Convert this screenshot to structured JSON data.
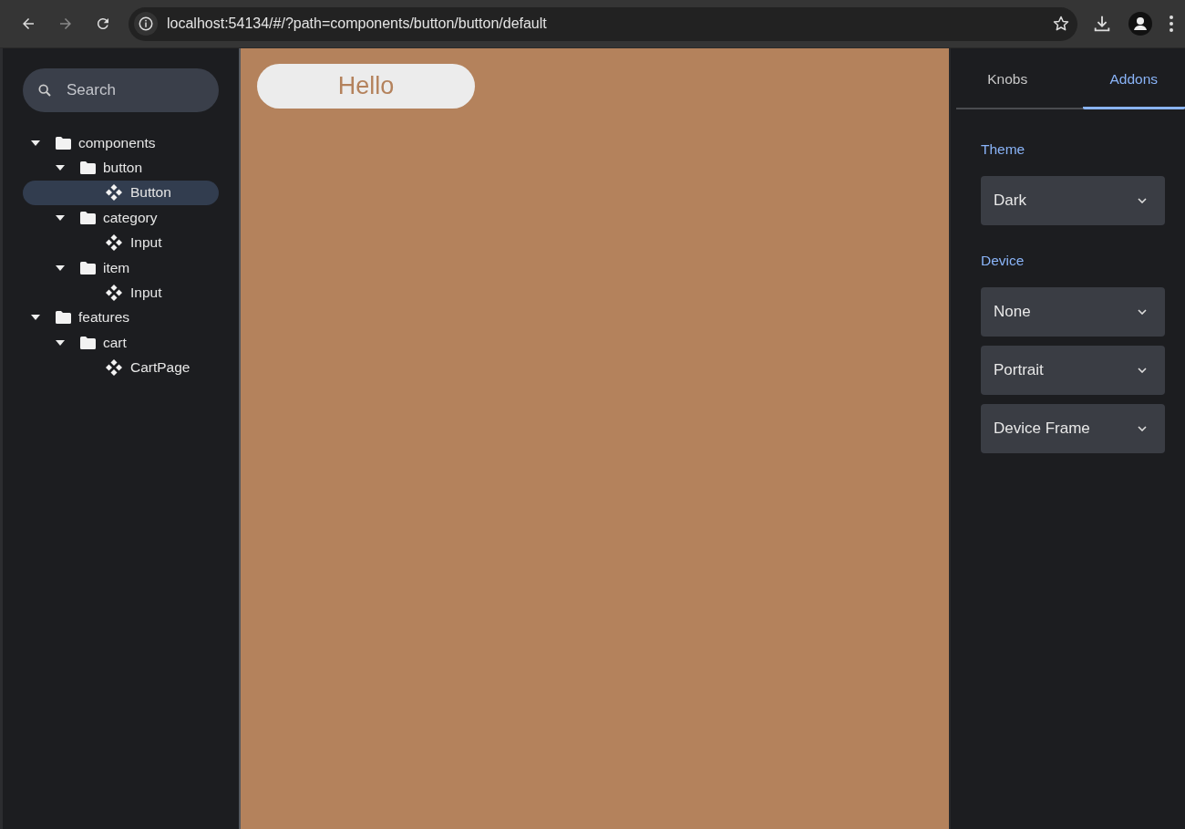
{
  "browser": {
    "url": "localhost:54134/#/?path=components/button/button/default"
  },
  "sidebar": {
    "search": {
      "placeholder": "Search"
    },
    "tree": [
      {
        "label": "components",
        "kind": "folder",
        "expanded": true,
        "selected": false,
        "children": [
          {
            "label": "button",
            "kind": "folder",
            "expanded": true,
            "selected": false,
            "children": [
              {
                "label": "Button",
                "kind": "story",
                "selected": true
              }
            ]
          },
          {
            "label": "category",
            "kind": "folder",
            "expanded": true,
            "selected": false,
            "children": [
              {
                "label": "Input",
                "kind": "story",
                "selected": false
              }
            ]
          },
          {
            "label": "item",
            "kind": "folder",
            "expanded": true,
            "selected": false,
            "children": [
              {
                "label": "Input",
                "kind": "story",
                "selected": false
              }
            ]
          }
        ]
      },
      {
        "label": "features",
        "kind": "folder",
        "expanded": true,
        "selected": false,
        "children": [
          {
            "label": "cart",
            "kind": "folder",
            "expanded": true,
            "selected": false,
            "children": [
              {
                "label": "CartPage",
                "kind": "story",
                "selected": false
              }
            ]
          }
        ]
      }
    ]
  },
  "canvas": {
    "button_label": "Hello"
  },
  "panel": {
    "tabs": [
      {
        "label": "Knobs",
        "selected": false
      },
      {
        "label": "Addons",
        "selected": true
      }
    ],
    "sections": [
      {
        "title": "Theme",
        "selects": [
          "Dark"
        ]
      },
      {
        "title": "Device",
        "selects": [
          "None",
          "Portrait",
          "Device Frame"
        ]
      }
    ]
  }
}
